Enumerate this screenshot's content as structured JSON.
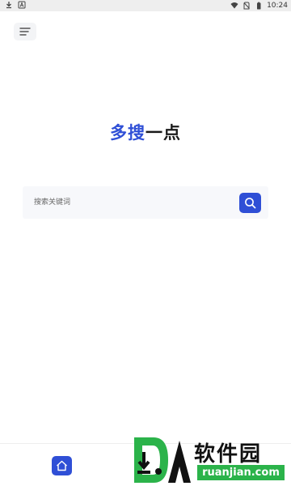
{
  "status_bar": {
    "time": "10:24",
    "left_icons": [
      "download-icon",
      "notification-a-icon"
    ],
    "right_icons": [
      "wifi-icon",
      "no-sim-icon",
      "battery-icon"
    ]
  },
  "header": {
    "menu_icon": "menu-icon"
  },
  "logo": {
    "part_blue": "多搜",
    "part_black": "一点",
    "blue_color": "#2f4fd6"
  },
  "search": {
    "placeholder": "搜索关键词",
    "button_icon": "search-icon",
    "button_color": "#2f4fd6"
  },
  "bottom_nav": {
    "items": [
      {
        "icon": "home-icon",
        "active": true
      }
    ]
  },
  "watermark": {
    "brand": "软件园",
    "url": "ruanjian.com"
  }
}
